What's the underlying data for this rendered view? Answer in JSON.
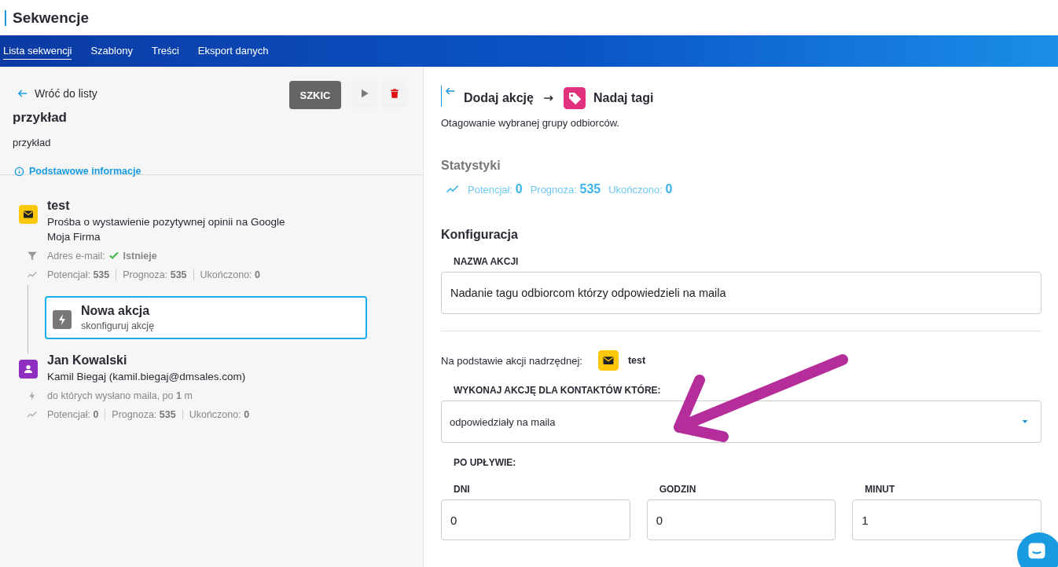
{
  "header": {
    "title": "Sekwencje"
  },
  "tabs": [
    {
      "label": "Lista sekwencji",
      "selected": true
    },
    {
      "label": "Szablony",
      "selected": false
    },
    {
      "label": "Treści",
      "selected": false
    },
    {
      "label": "Eksport danych",
      "selected": false
    }
  ],
  "sidebar": {
    "back": "Wróć do listy",
    "status": "SZKIC",
    "name": "przykład",
    "description": "przykład",
    "info_link": "Podstawowe informacje",
    "steps": [
      {
        "kind": "email",
        "title": "test",
        "lines": [
          "Prośba o wystawienie pozytywnej opinii na Google",
          "Moja Firma"
        ],
        "condition": {
          "kind": "filter",
          "text": "Adres e-mail:",
          "value": "Istnieje"
        },
        "stats": [
          {
            "label": "Potencjał:",
            "value": "535"
          },
          {
            "label": "Prognoza:",
            "value": "535"
          },
          {
            "label": "Ukończono:",
            "value": "0"
          }
        ],
        "children": [
          {
            "kind": "new",
            "title": "Nowa akcja",
            "lines": [
              "skonfiguruj akcję"
            ],
            "selected": true
          }
        ]
      },
      {
        "kind": "contact",
        "title": "Jan Kowalski",
        "lines": [
          "Kamil Biegaj (kamil.biegaj@dmsales.com)"
        ],
        "condition": {
          "kind": "trigger",
          "text": "do których wysłano maila, po **1** m"
        },
        "stats": [
          {
            "label": "Potencjał:",
            "value": "0"
          },
          {
            "label": "Prognoza:",
            "value": "535"
          },
          {
            "label": "Ukończono:",
            "value": "0"
          }
        ]
      }
    ]
  },
  "panel": {
    "crumb": "Dodaj akcję",
    "action": "Nadaj tagi",
    "description": "Otagowanie wybranej grupy odbiorców.",
    "stats_title": "Statystyki",
    "stats": [
      {
        "label": "Potencjał:",
        "value": "0"
      },
      {
        "label": "Prognoza:",
        "value": "535"
      },
      {
        "label": "Ukończono:",
        "value": "0"
      }
    ],
    "config_title": "Konfiguracja",
    "name_label": "NAZWA AKCJI",
    "name_value": "Nadanie tagu odbiorcom którzy odpowiedzieli na maila",
    "parent_label": "Na podstawie akcji nadrzędnej:",
    "parent_name": "test",
    "contacts_label": "WYKONAJ AKCJĘ DLA KONTAKTÓW KTÓRE:",
    "contacts_value": "odpowiedziały na maila",
    "delay_label": "PO UPŁYWIE:",
    "delay_fields": [
      {
        "label": "DNI",
        "value": "0"
      },
      {
        "label": "GODZIN",
        "value": "0"
      },
      {
        "label": "MINUT",
        "value": "1"
      }
    ]
  }
}
